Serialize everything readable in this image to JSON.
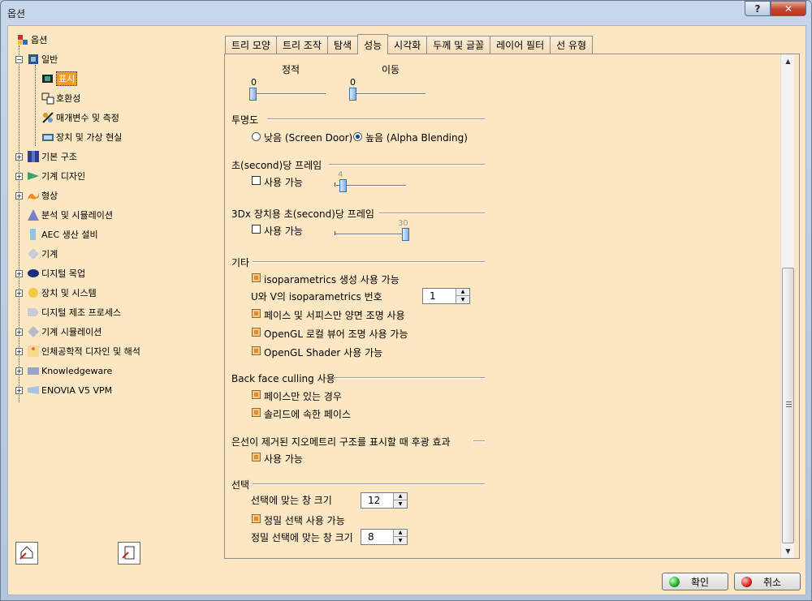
{
  "window": {
    "title": "옵션",
    "help_label": "?",
    "close_label": "✕"
  },
  "tree": {
    "root": "옵션",
    "items": [
      {
        "label": "일반"
      },
      {
        "label": "표시"
      },
      {
        "label": "호환성"
      },
      {
        "label": "매개변수 및 측정"
      },
      {
        "label": "장치 및 가상 현실"
      },
      {
        "label": "기본 구조"
      },
      {
        "label": "기계 디자인"
      },
      {
        "label": "형상"
      },
      {
        "label": "분석 및 시뮬레이션"
      },
      {
        "label": "AEC 생산 설비"
      },
      {
        "label": "기계"
      },
      {
        "label": "디지털 목업"
      },
      {
        "label": "장치 및 시스템"
      },
      {
        "label": "디지털 제조 프로세스"
      },
      {
        "label": "기계 시뮬레이션"
      },
      {
        "label": "인체공학적 디자인 및 해석"
      },
      {
        "label": "Knowledgeware"
      },
      {
        "label": "ENOVIA V5 VPM"
      }
    ]
  },
  "tabs": [
    {
      "label": "트리 모양"
    },
    {
      "label": "트리 조작"
    },
    {
      "label": "탐색"
    },
    {
      "label": "성능"
    },
    {
      "label": "시각화"
    },
    {
      "label": "두께 및 글꼴"
    },
    {
      "label": "레이어 필터"
    },
    {
      "label": "선 유형"
    }
  ],
  "performance": {
    "lod": {
      "static_label": "정적",
      "static_value": "0",
      "static_fraction": 0.0,
      "moving_label": "이동",
      "moving_value": "0",
      "moving_fraction": 0.0
    },
    "transparency": {
      "title": "투명도",
      "low_label": "낮음 (Screen Door)",
      "high_label": "높음 (Alpha Blending)",
      "selected": "high"
    },
    "fps": {
      "title": "초(second)당 프레임",
      "enable_label": "사용 가능",
      "enabled": false,
      "value": "4",
      "fraction": 0.04
    },
    "fps3dx": {
      "title": "3Dx 장치용 초(second)당 프레임",
      "enable_label": "사용 가능",
      "enabled": false,
      "value": "30",
      "fraction": 1.0
    },
    "other": {
      "title": "기타",
      "iso_enable_label": "isoparametrics 생성 사용 가능",
      "iso_enabled": true,
      "iso_count_label": "U와 V의 isoparametrics 번호",
      "iso_count": "1",
      "face_lighting_label": "페이스 및 서피스만 양면 조명 사용",
      "face_lighting": true,
      "opengl_local_label": "OpenGL 로컬 뷰어 조명 사용 가능",
      "opengl_local": true,
      "opengl_shader_label": "OpenGL Shader 사용 가능",
      "opengl_shader": true
    },
    "culling": {
      "title": "Back face culling 사용",
      "faces_only_label": "페이스만 있는 경우",
      "faces_only": true,
      "solid_faces_label": "솔리드에 속한 페이스",
      "solid_faces": true
    },
    "halo": {
      "title": "은선이 제거된 지오메트리 구조를 표시할 때 후광 효과",
      "enable_label": "사용 가능",
      "enabled": true
    },
    "selection": {
      "title": "선택",
      "window_size_label": "선택에 맞는 창 크기",
      "window_size": "12",
      "precise_label": "정밀 선택 사용 가능",
      "precise": true,
      "precise_size_label": "정밀 선택에 맞는 창 크기",
      "precise_size": "8"
    }
  },
  "buttons": {
    "ok": "확인",
    "cancel": "취소"
  },
  "colors": {
    "panel_bg": "#fde6c2",
    "selected_tree": "#f39c27",
    "check_fill": "#e48a2e"
  }
}
